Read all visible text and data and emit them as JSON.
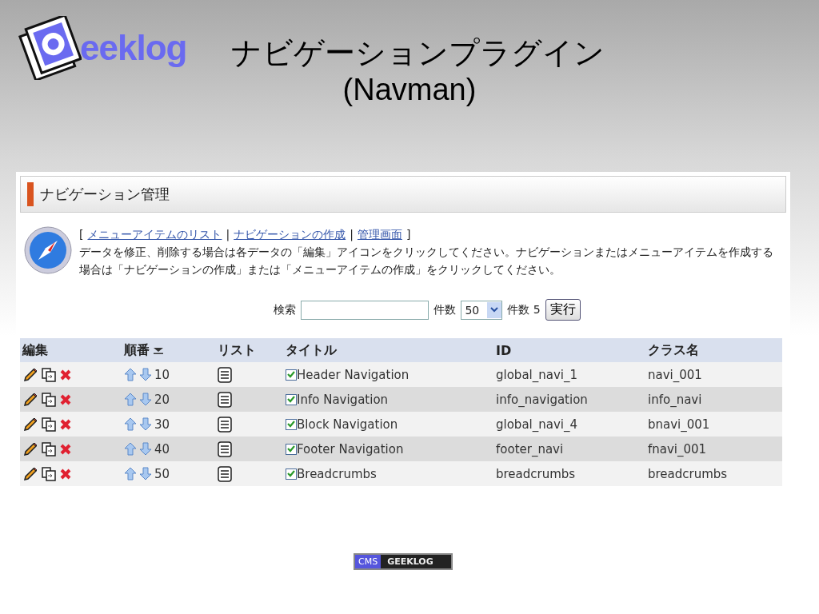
{
  "slide": {
    "logo": "eeklog",
    "title": "ナビゲーションプラグイン",
    "subtitle": "(Navman)"
  },
  "panel": {
    "heading": "ナビゲーション管理",
    "bracket_open": "[",
    "links": [
      "メニューアイテムのリスト",
      "ナビゲーションの作成",
      "管理画面"
    ],
    "separators": [
      "|",
      "|"
    ],
    "bracket_close": "]",
    "description": "データを修正、削除する場合は各データの「編集」アイコンをクリックしてください。ナビゲーションまたはメニューアイテムを作成する場合は「ナビゲーションの作成」または「メニューアイテムの作成」をクリックしてください。"
  },
  "search": {
    "label": "検索",
    "limit_label": "件数",
    "limit_value": "50",
    "count": "件数 5",
    "button": "実行"
  },
  "table": {
    "columns": [
      {
        "label": "編集",
        "sorted": false
      },
      {
        "label": "順番",
        "sorted": true
      },
      {
        "label": "リスト",
        "sorted": false
      },
      {
        "label": "タイトル",
        "sorted": false
      },
      {
        "label": "ID",
        "sorted": false
      },
      {
        "label": "クラス名",
        "sorted": false
      }
    ],
    "rows": [
      {
        "order": "10",
        "enabled": true,
        "title": "Header Navigation",
        "id": "global_navi_1",
        "class": "navi_001"
      },
      {
        "order": "20",
        "enabled": true,
        "title": "Info Navigation",
        "id": "info_navigation",
        "class": "info_navi"
      },
      {
        "order": "30",
        "enabled": true,
        "title": "Block Navigation",
        "id": "global_navi_4",
        "class": "bnavi_001"
      },
      {
        "order": "40",
        "enabled": true,
        "title": "Footer Navigation",
        "id": "footer_navi",
        "class": "fnavi_001"
      },
      {
        "order": "50",
        "enabled": true,
        "title": "Breadcrumbs",
        "id": "breadcrumbs",
        "class": "breadcrumbs"
      }
    ]
  },
  "footer_badge": [
    "CMS",
    "GEEKLOG"
  ]
}
